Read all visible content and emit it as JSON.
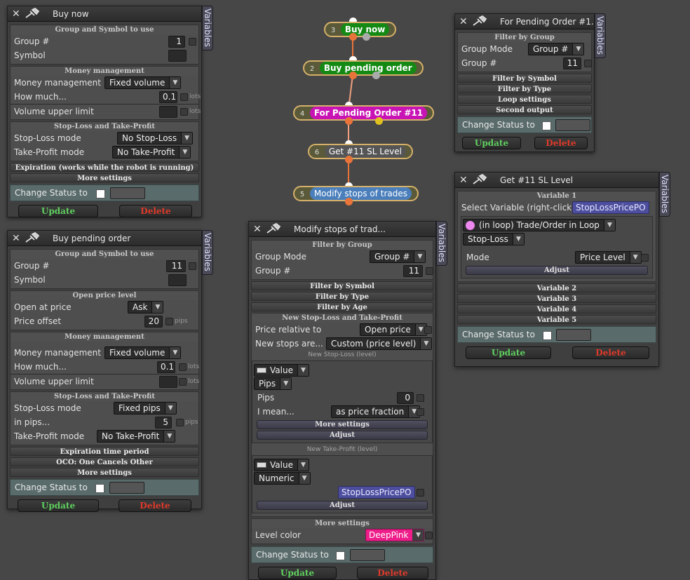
{
  "colors": {
    "update": "#5fd05f",
    "delete": "#e03a2a",
    "node_green": "#148a14",
    "node_magenta": "#c814b4",
    "node_gray": "#555555",
    "node_blue": "#4a7fbc",
    "wire": "#e8743a"
  },
  "vars_tab": "Variables",
  "flow": {
    "nodes": [
      {
        "num": "3",
        "label": "Buy now"
      },
      {
        "num": "2",
        "label": "Buy pending order"
      },
      {
        "num": "4",
        "label": "For Pending Order #11"
      },
      {
        "num": "6",
        "label": "Get #11 SL Level"
      },
      {
        "num": "5",
        "label": "Modify stops of trades"
      }
    ]
  },
  "common": {
    "update": "Update",
    "delete": "Delete",
    "change_status": "Change Status to"
  },
  "buy_now": {
    "title": "Buy now",
    "sec_group": "Group and Symbol to use",
    "group_label": "Group #",
    "group_value": "1",
    "symbol_label": "Symbol",
    "sec_money": "Money management",
    "mm_label": "Money management",
    "mm_value": "Fixed volume",
    "how_label": "How much...",
    "how_value": "0.1",
    "how_unit": "lots",
    "vol_label": "Volume upper limit",
    "vol_unit": "lots",
    "sec_sltp": "Stop-Loss and Take-Profit",
    "sl_label": "Stop-Loss mode",
    "sl_value": "No Stop-Loss",
    "tp_label": "Take-Profit mode",
    "tp_value": "No Take-Profit",
    "h_exp": "Expiration (works while the robot is running)",
    "h_more": "More settings"
  },
  "buy_pending": {
    "title": "Buy pending order",
    "sec_group": "Group and Symbol to use",
    "group_label": "Group #",
    "group_value": "11",
    "symbol_label": "Symbol",
    "sec_open": "Open price level",
    "open_label": "Open at price",
    "open_value": "Ask",
    "offset_label": "Price offset",
    "offset_value": "20",
    "offset_unit": "pips",
    "sec_money": "Money management",
    "mm_label": "Money management",
    "mm_value": "Fixed volume",
    "how_label": "How much...",
    "how_value": "0.1",
    "how_unit": "lots",
    "vol_label": "Volume upper limit",
    "vol_unit": "lots",
    "sec_sltp": "Stop-Loss and Take-Profit",
    "sl_label": "Stop-Loss mode",
    "sl_value": "Fixed pips",
    "inpips_label": "in pips...",
    "inpips_value": "5",
    "inpips_unit": "pips",
    "tp_label": "Take-Profit mode",
    "tp_value": "No Take-Profit",
    "h_exp": "Expiration time period",
    "h_oco": "OCO: One Cancels Other",
    "h_more": "More settings"
  },
  "for_pending": {
    "title": "For Pending Order #1...",
    "sec_filter": "Filter by Group",
    "gm_label": "Group Mode",
    "gm_value": "Group #",
    "g_label": "Group #",
    "g_value": "11",
    "h_symbol": "Filter by Symbol",
    "h_type": "Filter by Type",
    "h_loop": "Loop settings",
    "h_second": "Second output"
  },
  "get_sl": {
    "title": "Get #11 SL Level",
    "h_var1": "Variable 1",
    "sel_label": "Select Variable (right-click)",
    "sel_value": "StopLossPricePO",
    "src_value": "(in loop) Trade/Order in Loop",
    "kind_value": "Stop-Loss",
    "mode_label": "Mode",
    "mode_value": "Price Level",
    "adjust": "Adjust",
    "h_var2": "Variable 2",
    "h_var3": "Variable 3",
    "h_var4": "Variable 4",
    "h_var5": "Variable 5"
  },
  "modify": {
    "title": "Modify stops of trad...",
    "sec_filter": "Filter by Group",
    "gm_label": "Group Mode",
    "gm_value": "Group #",
    "g_label": "Group #",
    "g_value": "11",
    "h_symbol": "Filter by Symbol",
    "h_type": "Filter by Type",
    "h_age": "Filter by Age",
    "sec_new": "New Stop-Loss and Take-Profit",
    "rel_label": "Price relative to",
    "rel_value": "Open price",
    "stops_label": "New stops are...",
    "stops_value": "Custom (price level)",
    "sl_sub": "New Stop-Loss (level)",
    "sl_type": "Value",
    "sl_unit": "Pips",
    "pips_label": "Pips",
    "pips_value": "0",
    "mean_label": "I mean...",
    "mean_value": "as price fraction",
    "more": "More settings",
    "adjust": "Adjust",
    "tp_sub": "New Take-Profit (level)",
    "tp_type": "Value",
    "tp_num": "Numeric",
    "tp_var": "StopLossPricePO",
    "sec_more": "More settings",
    "lc_label": "Level color",
    "lc_value": "DeepPink"
  }
}
